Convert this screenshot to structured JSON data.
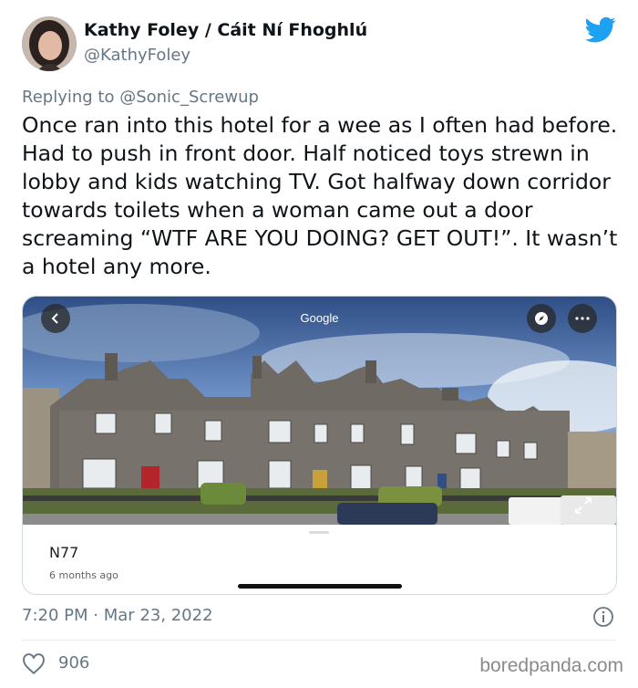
{
  "author": {
    "name": "Kathy Foley / Cáit Ní Fhoghlú",
    "handle": "@KathyFoley"
  },
  "reply": {
    "prefix": "Replying to ",
    "handle": "@Sonic_Screwup"
  },
  "tweet": {
    "text": "Once ran into this hotel for a wee as I often had before. Had to push in front door. Half noticed toys strewn in lobby and kids watching TV. Got halfway down corridor towards toilets when a woman came out a door screaming “WTF ARE YOU DOING? GET OUT!”. It wasn’t a hotel any more."
  },
  "card": {
    "provider_label": "Google",
    "place_name": "N77",
    "place_time": "6 months ago"
  },
  "meta": {
    "timestamp": "7:20 PM · Mar 23, 2022",
    "likes": "906"
  },
  "watermark": "boredpanda.com",
  "colors": {
    "twitter_blue": "#1DA1F2",
    "secondary_text": "#657786"
  },
  "icons": [
    "avatar",
    "twitter-bird-icon",
    "back-arrow-icon",
    "compass-icon",
    "more-icon",
    "expand-icon",
    "info-icon",
    "heart-icon"
  ]
}
